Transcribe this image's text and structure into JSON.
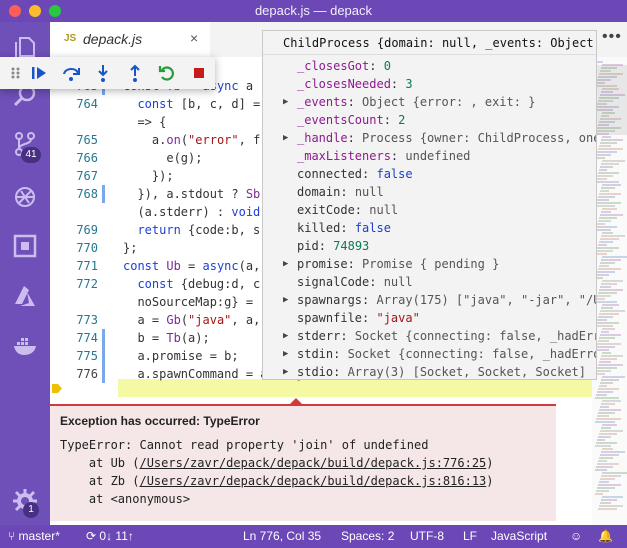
{
  "window": {
    "title": "depack.js — depack"
  },
  "activity": {
    "scm_badge": "41",
    "settings_badge": "1"
  },
  "tab": {
    "lang": "JS",
    "name": "depack.js",
    "close": "×"
  },
  "editor": {
    "lines": [
      {
        "num": "",
        "text": "t a;",
        "top": 0
      },
      {
        "num": "763",
        "text": "const Tb = async a"
      },
      {
        "num": "764",
        "text": "  const [b, c, d] ="
      },
      {
        "num": "",
        "text": "  => {"
      },
      {
        "num": "765",
        "text": "    a.on(\"error\", f"
      },
      {
        "num": "766",
        "text": "      e(g);"
      },
      {
        "num": "767",
        "text": "    });"
      },
      {
        "num": "768",
        "text": "  }), a.stdout ? Sb"
      },
      {
        "num": "",
        "text": "  (a.stderr) : void"
      },
      {
        "num": "769",
        "text": "  return {code:b, s"
      },
      {
        "num": "770",
        "text": "};"
      },
      {
        "num": "771",
        "text": "const Ub = async(a,"
      },
      {
        "num": "772",
        "text": "  const {debug:d, c"
      },
      {
        "num": "",
        "text": "  noSourceMap:g} ="
      },
      {
        "num": "773",
        "text": "  a = Gb(\"java\", a,"
      },
      {
        "num": "774",
        "text": "  b = Tb(a);"
      },
      {
        "num": "775",
        "text": "  a.promise = b;"
      },
      {
        "num": "776",
        "text": "  a.spawnCommand = a.ia.join(\" \");"
      }
    ]
  },
  "hover": {
    "title": "ChildProcess {domain: null, _events: Object,",
    "rows": [
      {
        "tw": "",
        "key": "_closesGot",
        "sep": ": ",
        "val": "0",
        "type": "num"
      },
      {
        "tw": "",
        "key": "_closesNeeded",
        "sep": ": ",
        "val": "3",
        "type": "num"
      },
      {
        "tw": "▶",
        "key": "_events",
        "sep": ": ",
        "val": "Object {error: , exit: }",
        "type": "obj"
      },
      {
        "tw": "",
        "key": "_eventsCount",
        "sep": ": ",
        "val": "2",
        "type": "num"
      },
      {
        "tw": "▶",
        "key": "_handle",
        "sep": ": ",
        "val": "Process {owner: ChildProcess, onexit",
        "type": "obj"
      },
      {
        "tw": "",
        "key": "_maxListeners",
        "sep": ": ",
        "val": "undefined",
        "type": "obj"
      },
      {
        "tw": "",
        "key": "connected",
        "sep": ": ",
        "val": "false",
        "type": "bool"
      },
      {
        "tw": "",
        "key": "domain",
        "sep": ": ",
        "val": "null",
        "type": "obj"
      },
      {
        "tw": "",
        "key": "exitCode",
        "sep": ": ",
        "val": "null",
        "type": "obj"
      },
      {
        "tw": "",
        "key": "killed",
        "sep": ": ",
        "val": "false",
        "type": "bool"
      },
      {
        "tw": "",
        "key": "pid",
        "sep": ": ",
        "val": "74893",
        "type": "num"
      },
      {
        "tw": "▶",
        "key": "promise",
        "sep": ": ",
        "val": "Promise { pending }",
        "type": "obj"
      },
      {
        "tw": "",
        "key": "signalCode",
        "sep": ": ",
        "val": "null",
        "type": "obj"
      },
      {
        "tw": "▶",
        "key": "spawnargs",
        "sep": ": ",
        "val": "Array(175) [\"java\", \"-jar\", \"/User",
        "type": "obj"
      },
      {
        "tw": "",
        "key": "spawnfile",
        "sep": ": ",
        "val": "\"java\"",
        "type": "str"
      },
      {
        "tw": "▶",
        "key": "stderr",
        "sep": ": ",
        "val": "Socket {connecting: false, _hadError:",
        "type": "obj"
      },
      {
        "tw": "▶",
        "key": "stdin",
        "sep": ": ",
        "val": "Socket {connecting: false, _hadError:",
        "type": "obj"
      },
      {
        "tw": "▶",
        "key": "stdio",
        "sep": ": ",
        "val": "Array(3) [Socket, Socket, Socket]",
        "type": "obj"
      }
    ]
  },
  "exception": {
    "title": "Exception has occurred: TypeError",
    "message": "TypeError: Cannot read property 'join' of undefined",
    "frames": [
      {
        "prefix": "    at Ub (",
        "link": "/Users/zavr/depack/depack/build/depack.js:776:25",
        "suffix": ")"
      },
      {
        "prefix": "    at Zb (",
        "link": "/Users/zavr/depack/depack/build/depack.js:816:13",
        "suffix": ")"
      },
      {
        "prefix": "    at <anonymous>",
        "link": "",
        "suffix": ""
      }
    ]
  },
  "status": {
    "branch": "master*",
    "sync": "0↓ 11↑",
    "position": "Ln 776, Col 35",
    "spaces": "Spaces: 2",
    "encoding": "UTF-8",
    "eol": "LF",
    "language": "JavaScript"
  },
  "colors": {
    "titlebar": "#6c47b6",
    "activitybar": "#6f4fb8",
    "statusbar": "#6c47b6",
    "exception_border": "#d13b3b",
    "current_line": "#f5f9a3"
  }
}
